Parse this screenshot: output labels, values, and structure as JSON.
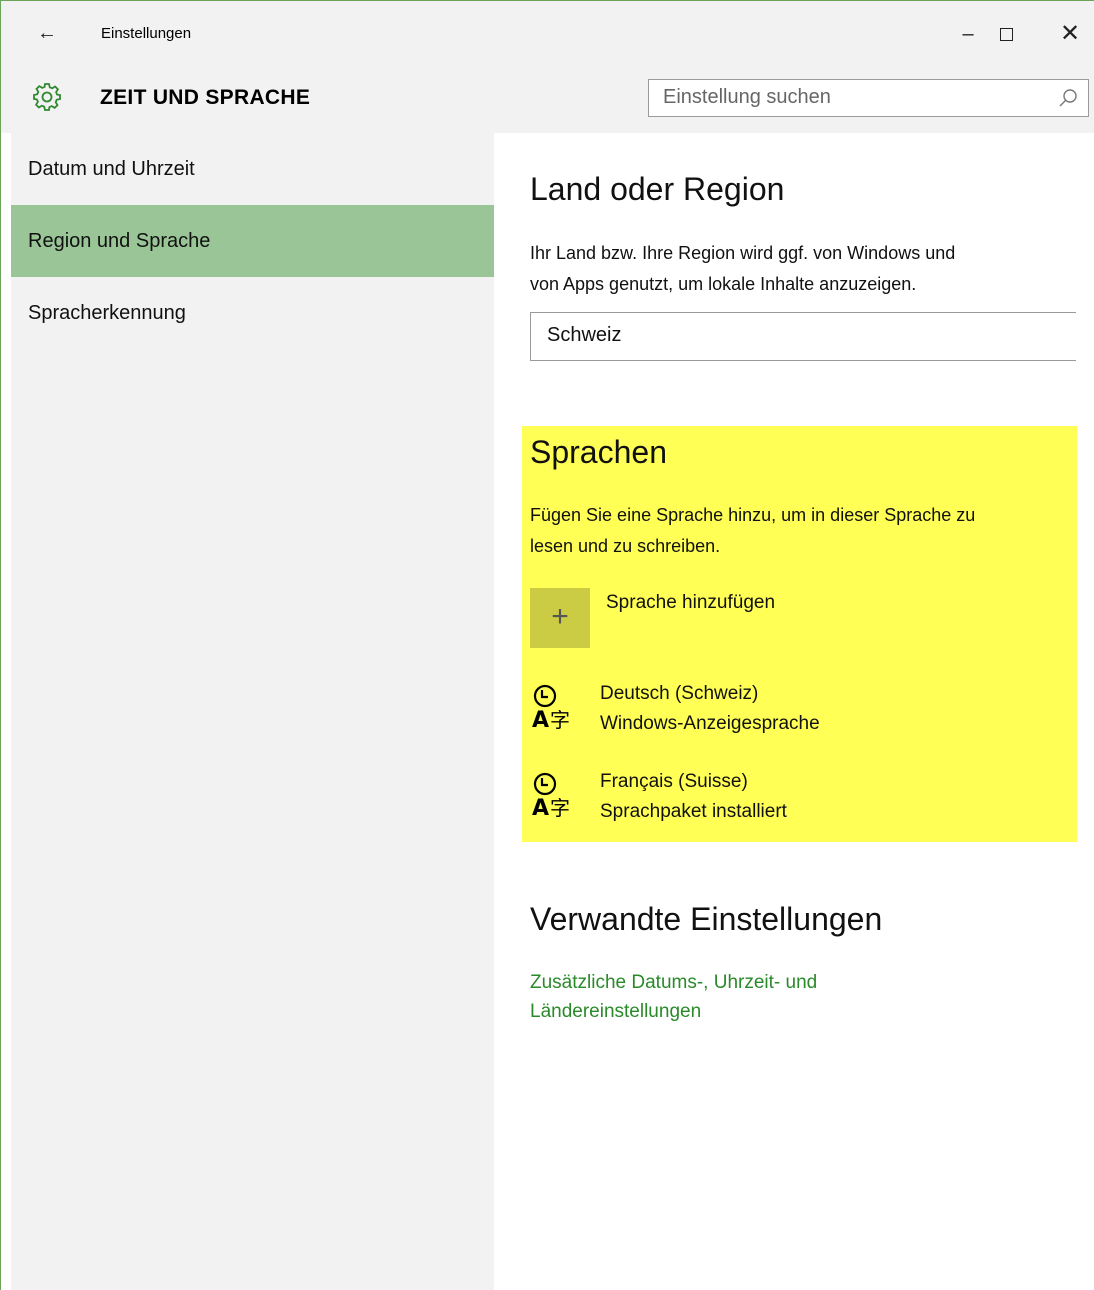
{
  "window": {
    "title": "Einstellungen",
    "back_label": "←",
    "minimize_label": "–",
    "close_label": "✕"
  },
  "header": {
    "icon": "gear-icon",
    "title": "ZEIT UND SPRACHE",
    "search": {
      "placeholder": "Einstellung suchen",
      "value": ""
    }
  },
  "sidebar": {
    "items": [
      {
        "label": "Datum und Uhrzeit",
        "selected": false
      },
      {
        "label": "Region und Sprache",
        "selected": true
      },
      {
        "label": "Spracherkennung",
        "selected": false
      }
    ]
  },
  "main": {
    "region": {
      "heading": "Land oder Region",
      "description_line1": "Ihr Land bzw. Ihre Region wird ggf. von Windows und",
      "description_line2": "von Apps genutzt, um lokale Inhalte anzuzeigen.",
      "selected_country": "Schweiz"
    },
    "languages": {
      "heading": "Sprachen",
      "description_line1": "Fügen Sie eine Sprache hinzu, um in dieser Sprache zu",
      "description_line2": "lesen und zu schreiben.",
      "add_icon": "+",
      "add_label": "Sprache hinzufügen",
      "items": [
        {
          "name": "Deutsch (Schweiz)",
          "status": "Windows-Anzeigesprache",
          "icon": "language-icon"
        },
        {
          "name": "Français (Suisse)",
          "status": "Sprachpaket installiert",
          "icon": "language-icon"
        }
      ],
      "highlight_color": "#ffff55"
    },
    "related": {
      "heading": "Verwandte Einstellungen",
      "link_line1": "Zusätzliche Datums-, Uhrzeit- und",
      "link_line2": "Ländereinstellungen",
      "link_color": "#2a8a2a"
    }
  },
  "colors": {
    "accent": "#9ac697",
    "sidebar_bg": "#f2f2f2"
  }
}
